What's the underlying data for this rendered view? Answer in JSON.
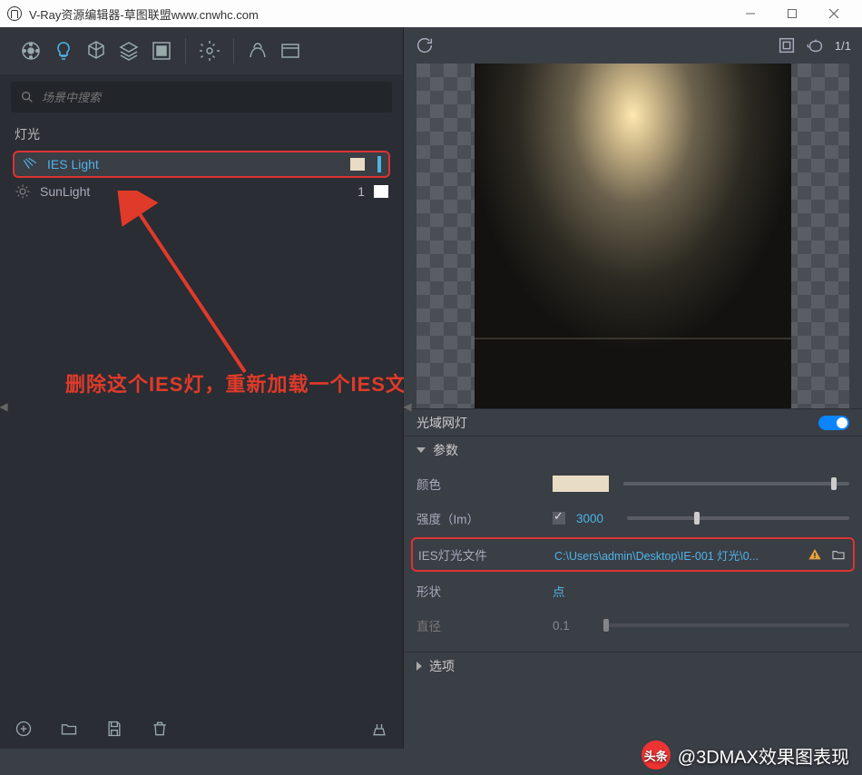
{
  "titlebar": {
    "title": "V-Ray资源编辑器-草图联盟www.cnwhc.com"
  },
  "search": {
    "placeholder": "场景中搜索"
  },
  "section": {
    "lights": "灯光"
  },
  "list": {
    "items": [
      {
        "name": "IES Light",
        "count": "",
        "selected": true
      },
      {
        "name": "SunLight",
        "count": "1",
        "selected": false
      }
    ]
  },
  "annotation": "删除这个IES灯，重新加载一个IES文件",
  "right_toolbar": {
    "fraction": "1/1"
  },
  "panel": {
    "title": "光域网灯",
    "section_params": "参数",
    "section_options": "选项",
    "rows": {
      "color_label": "颜色",
      "intensity_label": "强度（Im）",
      "intensity_value": "3000",
      "iesfile_label": "IES灯光文件",
      "iesfile_path": "C:\\Users\\admin\\Desktop\\IE-001 灯光\\0...",
      "shape_label": "形状",
      "shape_value": "点",
      "diameter_label": "直径",
      "diameter_value": "0.1"
    }
  },
  "watermark": {
    "badge": "头条",
    "text": "@3DMAX效果图表现"
  }
}
